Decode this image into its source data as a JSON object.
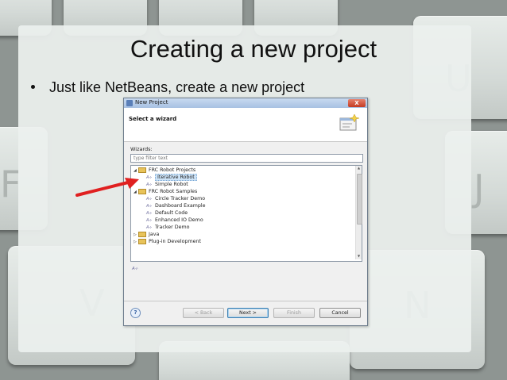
{
  "slide": {
    "title": "Creating a new project",
    "bullet": "Just like NetBeans, create a new project"
  },
  "background": {
    "key_chars": [
      "U",
      "F",
      "J",
      "V",
      "N"
    ]
  },
  "dialog": {
    "window_title": "New Project",
    "close_label": "X",
    "header_title": "Select a wizard",
    "wizards_label": "Wizards:",
    "filter_placeholder": "type filter text",
    "tree": [
      {
        "label": "FRC Robot Projects",
        "type": "folder",
        "expanded": true
      },
      {
        "label": "Iterative Robot",
        "type": "wizard",
        "selected": true
      },
      {
        "label": "Simple Robot",
        "type": "wizard"
      },
      {
        "label": "FRC Robot Samples",
        "type": "folder",
        "expanded": true
      },
      {
        "label": "Circle Tracker Demo",
        "type": "wizard"
      },
      {
        "label": "Dashboard Example",
        "type": "wizard"
      },
      {
        "label": "Default Code",
        "type": "wizard"
      },
      {
        "label": "Enhanced IO Demo",
        "type": "wizard"
      },
      {
        "label": "Tracker Demo",
        "type": "wizard"
      },
      {
        "label": "Java",
        "type": "folder",
        "expanded": false
      },
      {
        "label": "Plug-in Development",
        "type": "folder",
        "expanded": false
      }
    ],
    "buttons": {
      "help": "?",
      "back": "< Back",
      "next": "Next >",
      "finish": "Finish",
      "cancel": "Cancel"
    }
  },
  "colors": {
    "arrow": "#e02020",
    "selection": "#cde3f7"
  }
}
